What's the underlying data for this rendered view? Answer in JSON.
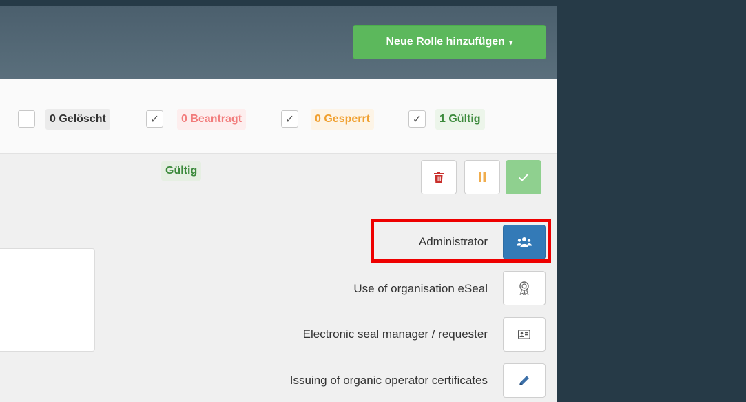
{
  "header": {
    "add_role_label": "Neue Rolle hinzufügen",
    "add_role_caret": "▾"
  },
  "filters": [
    {
      "checkbox": "",
      "label": "0 Gelöscht"
    },
    {
      "checkbox": "✓",
      "label": "0 Beantragt"
    },
    {
      "checkbox": "✓",
      "label": "0 Gesperrt"
    },
    {
      "checkbox": "✓",
      "label": "1 Gültig"
    }
  ],
  "role_card": {
    "status_label": "Gültig",
    "roles": [
      {
        "label": "Administrator",
        "icon": "users-icon",
        "active": true
      },
      {
        "label": "Use of organisation eSeal",
        "icon": "award-icon",
        "active": false
      },
      {
        "label": "Electronic seal manager / requester",
        "icon": "id-card-icon",
        "active": false
      },
      {
        "label": "Issuing of organic operator certificates",
        "icon": "pencil-icon",
        "active": false
      }
    ]
  },
  "colors": {
    "header_bg": "#52677a",
    "add_button": "#5cb85c",
    "active_role_button": "#337ab7",
    "highlight_border": "#ee0000",
    "delete_icon": "#c9302c",
    "suspend_icon": "#f0ad4e",
    "valid_button": "#8fd08f"
  }
}
